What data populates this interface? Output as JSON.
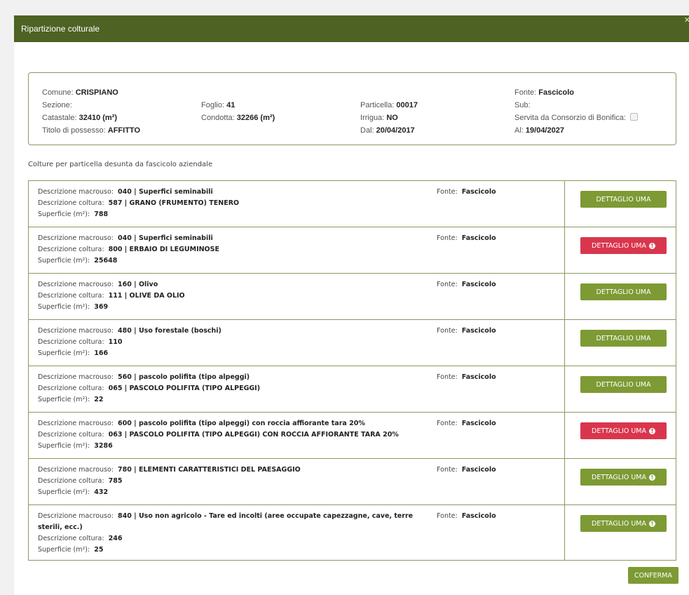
{
  "modal": {
    "title": "Ripartizione colturale",
    "close_icon": "x-icon"
  },
  "info": {
    "comune_label": "Comune:",
    "comune_value": "CRISPIANO",
    "sezione_label": "Sezione:",
    "sezione_value": "",
    "catastale_label": "Catastale:",
    "catastale_value": "32410 (m²)",
    "titolo_label": "Titolo di possesso:",
    "titolo_value": "AFFITTO",
    "foglio_label": "Foglio:",
    "foglio_value": "41",
    "condotta_label": "Condotta:",
    "condotta_value": "32266 (m²)",
    "particella_label": "Particella:",
    "particella_value": "00017",
    "irrigua_label": "Irrigua:",
    "irrigua_value": "NO",
    "dal_label": "Dal:",
    "dal_value": "20/04/2017",
    "fonte_label": "Fonte:",
    "fonte_value": "Fascicolo",
    "sub_label": "Sub:",
    "sub_value": "",
    "consorzio_label": "Servita da Consorzio di Bonifica:",
    "consorzio_checked": false,
    "al_label": "Al:",
    "al_value": "19/04/2027"
  },
  "section_label": "Colture per particella desunta da fascicolo aziendale",
  "labels": {
    "macrouso": "Descrizione macrouso:",
    "coltura": "Descrizione coltura:",
    "superficie": "Superficie (m²):",
    "fonte": "Fonte:"
  },
  "rows": [
    {
      "macrouso": "040 | Superfici seminabili",
      "coltura": "587 | GRANO (FRUMENTO) TENERO",
      "superficie": "788",
      "fonte": "Fascicolo",
      "button": "DETTAGLIO UMA",
      "status": "ok"
    },
    {
      "macrouso": "040 | Superfici seminabili",
      "coltura": "800 | ERBAIO DI LEGUMINOSE",
      "superficie": "25648",
      "fonte": "Fascicolo",
      "button": "DETTAGLIO UMA",
      "status": "error"
    },
    {
      "macrouso": "160 | Olivo",
      "coltura": "111 | OLIVE DA OLIO",
      "superficie": "369",
      "fonte": "Fascicolo",
      "button": "DETTAGLIO UMA",
      "status": "ok"
    },
    {
      "macrouso": "480 | Uso forestale (boschi)",
      "coltura": "110",
      "superficie": "166",
      "fonte": "Fascicolo",
      "button": "DETTAGLIO UMA",
      "status": "ok"
    },
    {
      "macrouso": "560 | pascolo polifita (tipo alpeggi)",
      "coltura": "065 | PASCOLO POLIFITA (TIPO ALPEGGI)",
      "superficie": "22",
      "fonte": "Fascicolo",
      "button": "DETTAGLIO UMA",
      "status": "ok"
    },
    {
      "macrouso": "600 | pascolo polifita (tipo alpeggi) con roccia affiorante tara 20%",
      "coltura": "063 | PASCOLO POLIFITA (TIPO ALPEGGI) CON ROCCIA AFFIORANTE TARA 20%",
      "superficie": "3286",
      "fonte": "Fascicolo",
      "button": "DETTAGLIO UMA",
      "status": "error"
    },
    {
      "macrouso": "780 | ELEMENTI CARATTERISTICI DEL PAESAGGIO",
      "coltura": "785",
      "superficie": "432",
      "fonte": "Fascicolo",
      "button": "DETTAGLIO UMA",
      "status": "warning"
    },
    {
      "macrouso": "840 | Uso non agricolo - Tare ed incolti (aree occupate capezzagne, cave, terre sterili, ecc.)",
      "coltura": "246",
      "superficie": "25",
      "fonte": "Fascicolo",
      "button": "DETTAGLIO UMA",
      "status": "warning"
    }
  ],
  "confirm_label": "CONFERMA",
  "colors": {
    "header": "#4d6223",
    "button_green": "#7d9a34",
    "button_red": "#d9364d",
    "border": "#8a9a60"
  }
}
